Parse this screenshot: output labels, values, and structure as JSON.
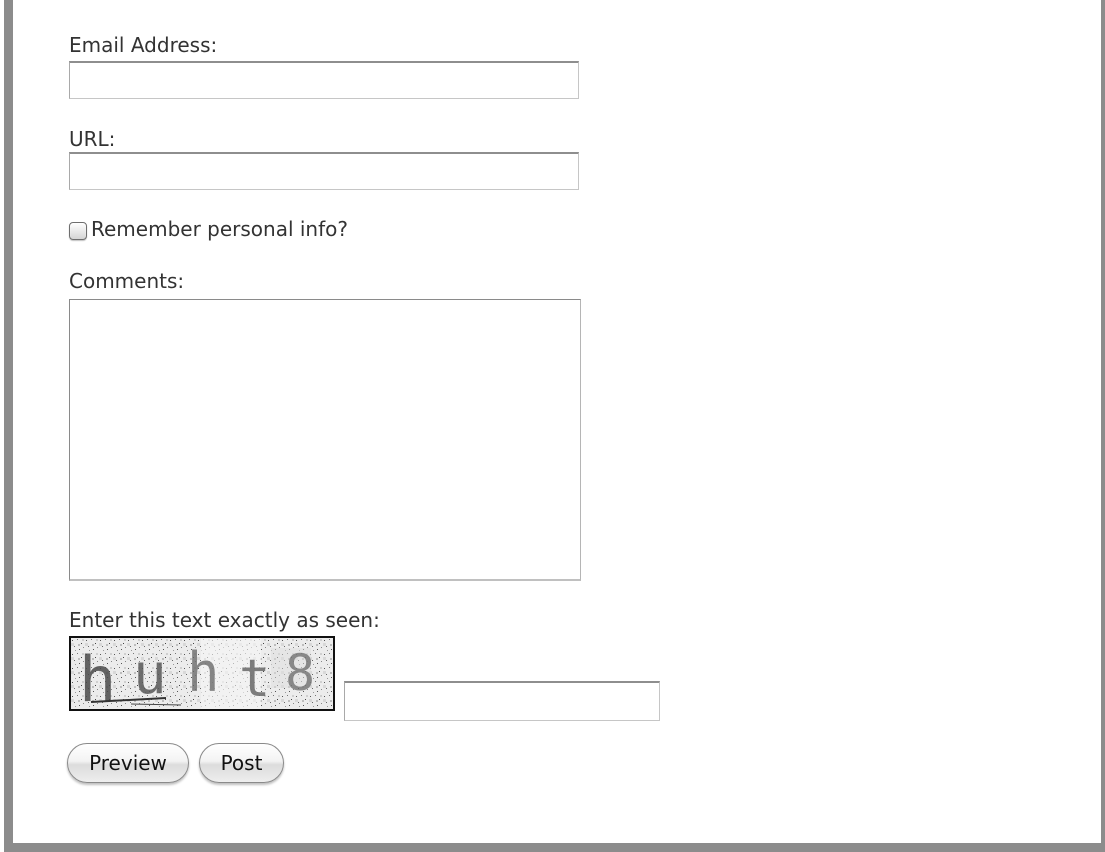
{
  "form": {
    "email_label": "Email Address:",
    "email_value": "",
    "url_label": "URL:",
    "url_value": "",
    "remember_label": "Remember personal info?",
    "remember_checked": false,
    "comments_label": "Comments:",
    "comments_value": "",
    "captcha_label": "Enter this text exactly as seen:",
    "captcha_text": "huht8",
    "captcha_value": "",
    "preview_label": "Preview",
    "post_label": "Post"
  },
  "colors": {
    "border_frame": "#8c8c8c",
    "text": "#333333"
  }
}
